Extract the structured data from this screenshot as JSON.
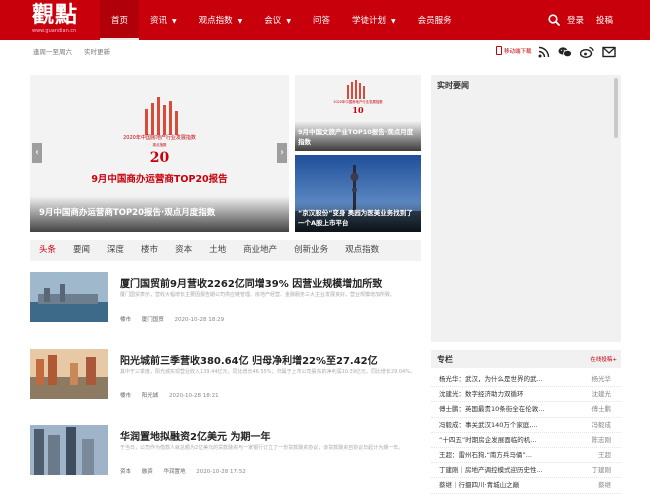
{
  "header": {
    "logo_text": "觀點",
    "logo_url": "www.guandian.cn",
    "nav": [
      {
        "label": "首页",
        "caret": false,
        "active": true
      },
      {
        "label": "资讯",
        "caret": true,
        "active": false
      },
      {
        "label": "观点指数",
        "caret": true,
        "active": false
      },
      {
        "label": "会议",
        "caret": true,
        "active": false
      },
      {
        "label": "问答",
        "caret": false,
        "active": false
      },
      {
        "label": "学徒计划",
        "caret": true,
        "active": false
      },
      {
        "label": "会员服务",
        "caret": false,
        "active": false
      }
    ],
    "login": "登录",
    "submit": "投稿"
  },
  "subbar": {
    "days": "逢周一至周六",
    "update": "实时更新",
    "mobile_download": "移动端下载"
  },
  "hero": {
    "caption": "9月中国商办运营商TOP20报告·观点月度指数",
    "inner_title": "9月中国商办运营商TOP20报告",
    "poster_text": "2020年中国房地产行业发展指数",
    "poster_sub": "观点指数",
    "poster_num": "20"
  },
  "side_items": [
    {
      "caption": "9月中国文旅产业TOP10报告·观点月度指数",
      "poster_text": "2020年中国房地产行业发展指数",
      "poster_num": "10"
    },
    {
      "caption": "“京汉股份”变身 奥园为医美业务找到了一个A股上市平台"
    }
  ],
  "categories": [
    "头条",
    "要闻",
    "深度",
    "楼市",
    "资本",
    "土地",
    "商业地产",
    "创新业务",
    "观点指数"
  ],
  "articles": [
    {
      "title": "厦门国贸前9月营收2262亿同增39% 因营业规模增加所致",
      "desc": "厦门国贸表示，营收大幅增长主要因报告期公司供应链管理、房地产经营、金融服务三大主业发展良好，营业规模增加所致。",
      "tags": [
        "楼市",
        "厦门国贸"
      ],
      "time": "2020-10-28 18:29"
    },
    {
      "title": "阳光城前三季营收380.64亿 归母净利增22%至27.42亿",
      "desc": "其中于三季度，阳光城实现营业收入139.44亿元，同比增长46.55%；归属于上市公司股东的净利润10.39亿元，同比增长29.04%。",
      "tags": [
        "楼市",
        "阳光城"
      ],
      "time": "2020-10-28 18:21"
    },
    {
      "title": "华润置地拟融资2亿美元 为期一年",
      "desc": "于当日，公司作为借款人就总额为2亿美元的贷款融资与一家银行订立了一份贷款融资协议，该贷款融资自协议日起计为期一年。",
      "tags": [
        "资本",
        "融资",
        "华润置地"
      ],
      "time": "2020-10-28 17:52"
    }
  ],
  "realtime": {
    "header": "实时要闻"
  },
  "column": {
    "header": "专栏",
    "more": "在线投稿+",
    "items": [
      {
        "title": "杨光华：武汉，为什么是世界的武...",
        "author": "杨光华"
      },
      {
        "title": "沈建光：数字经济助力双循环",
        "author": "沈建光"
      },
      {
        "title": "傅士鹏：英国最贵10条街全在伦敦...",
        "author": "傅士鹏"
      },
      {
        "title": "冯毅成：事关武汉140万个家庭,...",
        "author": "冯毅成"
      },
      {
        "title": "“十四五”时期房企发展面临的机...",
        "author": "陈志刚"
      },
      {
        "title": "王超：雷州石狗,“南方兵马俑”...",
        "author": "王超"
      },
      {
        "title": "丁建刚｜房地产调控模式迎历史性...",
        "author": "丁建刚"
      },
      {
        "title": "蔡继｜行摄四川·青城山之巅",
        "author": "蔡继"
      }
    ]
  },
  "colors": {
    "brand_red": "#c7000b",
    "panel_gray": "#f1f1f1"
  }
}
